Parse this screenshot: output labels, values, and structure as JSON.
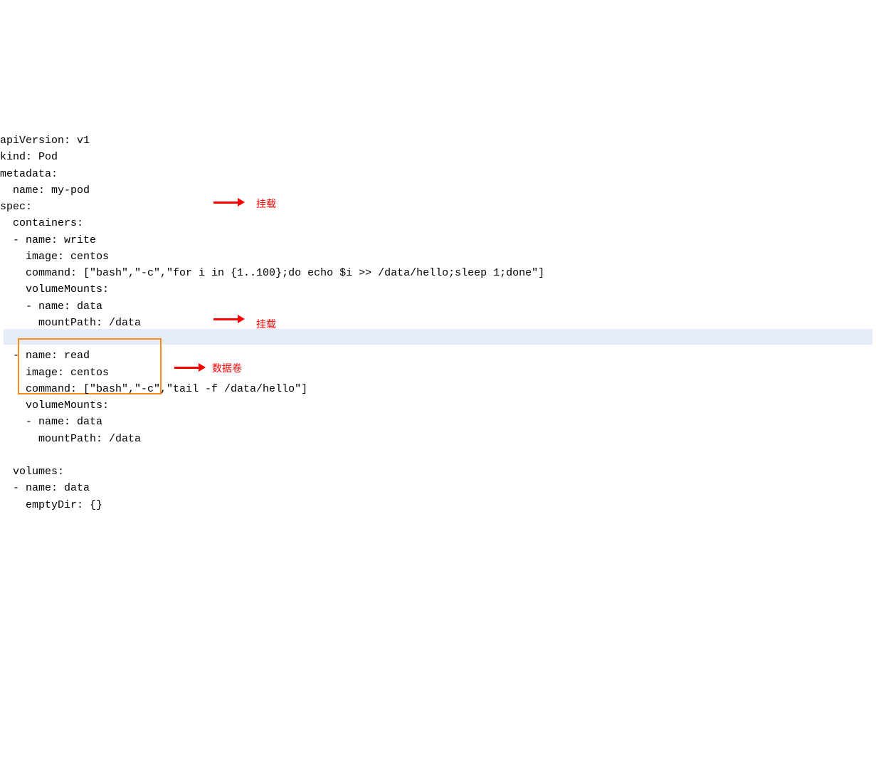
{
  "code": {
    "l01": "apiVersion: v1",
    "l02": "kind: Pod",
    "l03": "metadata:",
    "l04": "  name: my-pod",
    "l05": "spec:",
    "l06": "  containers:",
    "l07": "  - name: write",
    "l08": "    image: centos",
    "l09": "    command: [\"bash\",\"-c\",\"for i in {1..100};do echo $i >> /data/hello;sleep 1;done\"]",
    "l10": "    volumeMounts:",
    "l11": "    - name: data",
    "l12a": "      mountPa",
    "l12b": "th: /data",
    "l13": "",
    "l14": "  - name: read",
    "l15": "    image: centos",
    "l16": "    command: [\"bash\",\"-c\",\"tail -f /data/hello\"]",
    "l17": "    volumeMounts:",
    "l18": "    - name: data",
    "l19": "      mountPath: /data",
    "l20": "",
    "l21": "  volumes:",
    "l22": "  - name: data",
    "l23": "    emptyDir: {}"
  },
  "annotations": {
    "mount1": "挂载",
    "mount2": "挂载",
    "volume": "数据卷"
  }
}
